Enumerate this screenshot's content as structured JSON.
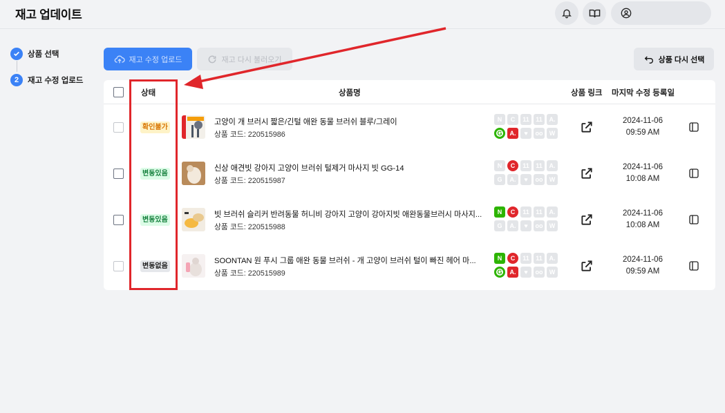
{
  "header": {
    "title": "재고 업데이트"
  },
  "steps": [
    {
      "label": "상품 선택",
      "state": "done"
    },
    {
      "number": "2",
      "label": "재고 수정 업로드",
      "state": "active"
    }
  ],
  "toolbar": {
    "upload_label": "재고 수정 업로드",
    "reload_label": "재고 다시 불러오기",
    "reselect_label": "상품 다시 선택"
  },
  "table": {
    "columns": {
      "status": "상태",
      "name": "상품명",
      "link": "상품 링크",
      "modified": "마지막 수정 등록일"
    },
    "rows": [
      {
        "status": "확인불가",
        "status_kind": "warning",
        "name": "고양이 개 브러시 짧은/긴털 애완 동물 브러쉬 블루/그레이",
        "code": "상품 코드: 220515986",
        "date": "2024-11-06",
        "time": "09:59 AM",
        "markets": {
          "row1": [
            "gray",
            "gray",
            "gray",
            "gray",
            "gray"
          ],
          "row2": [
            "google-green",
            "a-red",
            "gray",
            "gray",
            "gray"
          ]
        }
      },
      {
        "status": "변동있음",
        "status_kind": "changed",
        "name": "신상 애견빗 강아지 고양이 브러쉬 털제거 마사지 빗 GG-14",
        "code": "상품 코드: 220515987",
        "date": "2024-11-06",
        "time": "10:08 AM",
        "markets": {
          "row1": [
            "gray",
            "c-red",
            "gray",
            "gray",
            "gray"
          ],
          "row2": [
            "gray",
            "gray",
            "gray",
            "gray",
            "gray"
          ]
        }
      },
      {
        "status": "변동있음",
        "status_kind": "changed",
        "name": "빗 브러쉬 슬리커 반려동물 허니비 강아지 고양이 강아지빗 애완동물브러시 마사지...",
        "code": "상품 코드: 220515988",
        "date": "2024-11-06",
        "time": "10:08 AM",
        "markets": {
          "row1": [
            "n-green",
            "c-red",
            "gray",
            "gray",
            "gray"
          ],
          "row2": [
            "gray",
            "gray",
            "gray",
            "gray",
            "gray"
          ]
        }
      },
      {
        "status": "변동없음",
        "status_kind": "none",
        "name": "SOONTAN 원 푸시 그룹 애완 동물 브러쉬 - 개 고양이 브러쉬 털이 빠진 헤어 마...",
        "code": "상품 코드: 220515989",
        "date": "2024-11-06",
        "time": "09:59 AM",
        "markets": {
          "row1": [
            "n-green",
            "c-red",
            "gray",
            "gray",
            "gray"
          ],
          "row2": [
            "google-green",
            "a-red",
            "gray",
            "gray",
            "gray"
          ]
        }
      }
    ]
  },
  "market_glyphs": {
    "row1": [
      "N",
      "C",
      "11",
      "11",
      "A."
    ],
    "row2": [
      "G",
      "A.",
      "♥",
      "oo",
      "W"
    ]
  },
  "colors": {
    "accent": "#3b82f6",
    "annotation": "#e0262b",
    "naver_green": "#2db400",
    "coupang_red": "#e0262b"
  }
}
